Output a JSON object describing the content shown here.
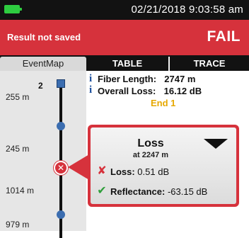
{
  "status_bar": {
    "datetime": "02/21/2018 9:03:58 am",
    "battery_icon": "battery-full-icon",
    "battery_color": "#2ecc40"
  },
  "result_bar": {
    "message": "Result not saved",
    "verdict": "FAIL",
    "color": "#d6323c"
  },
  "tabs": [
    {
      "label": "EventMap",
      "active": true
    },
    {
      "label": "TABLE",
      "active": false
    },
    {
      "label": "TRACE",
      "active": false
    }
  ],
  "event_map": {
    "marker_label": "2",
    "distances": [
      "255 m",
      "245 m",
      "1014 m",
      "979 m"
    ]
  },
  "summary": {
    "fiber_length_label": "Fiber Length:",
    "fiber_length_value": "2747 m",
    "overall_loss_label": "Overall Loss:",
    "overall_loss_value": "16.12 dB",
    "end_label": "End 1"
  },
  "event_popup": {
    "title": "Loss",
    "subtitle": "at 2247 m",
    "loss_label": "Loss:",
    "loss_value": "0.51 dB",
    "loss_status": "fail",
    "reflectance_label": "Reflectance:",
    "reflectance_value": "-63.15 dB",
    "reflectance_status": "pass",
    "fail_color": "#d6323c",
    "pass_color": "#2e9e3a"
  }
}
